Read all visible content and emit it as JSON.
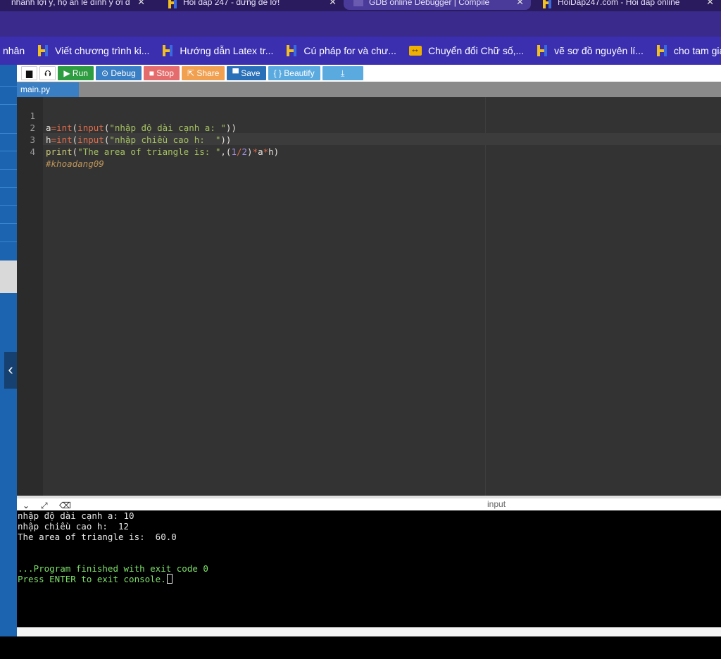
{
  "browser": {
    "tabs": [
      {
        "title": "nhanh lợi ý, hộ ăn lê đính ý ơi đ"
      },
      {
        "title": "Hỏi đáp 247 - đừng để lỡ!"
      },
      {
        "title": "GDB online Debugger | Compile"
      },
      {
        "title": "HoiDap247.com - Hỏi đáp online"
      }
    ],
    "close_glyph": "✕"
  },
  "bookmarks": [
    {
      "label": "nhân",
      "icon": "none"
    },
    {
      "label": "Viết chương trình ki...",
      "icon": "hoidap-icon"
    },
    {
      "label": "Hướng dẫn Latex tr...",
      "icon": "hoidap-icon"
    },
    {
      "label": "Cú pháp for và chư...",
      "icon": "hoidap-icon"
    },
    {
      "label": "Chuyển đổi Chữ số,...",
      "icon": "converter-icon"
    },
    {
      "label": "vẽ sơ đồ nguyên lí...",
      "icon": "hoidap-icon"
    },
    {
      "label": "cho tam giác ABC,",
      "icon": "hoidap-icon"
    }
  ],
  "toolbar": {
    "run": "▶ Run",
    "debug": "⊙ Debug",
    "stop": "■ Stop",
    "share": "⇱ Share",
    "save": "▀ Save",
    "beautify": "{ } Beautify",
    "download": "⤓"
  },
  "file_tab": "main.py",
  "editor": {
    "lines": [
      {
        "n": "1"
      },
      {
        "n": "2"
      },
      {
        "n": "3"
      },
      {
        "n": "4"
      }
    ]
  },
  "console": {
    "label": "input",
    "lines": [
      "nhập độ dài cạnh a: 10",
      "nhập chiều cao h:  12",
      "The area of triangle is:  60.0",
      "...Program finished with exit code 0",
      "Press ENTER to exit console."
    ]
  },
  "colors": {
    "sidebar": "#1c64b0",
    "run": "#2e9c40",
    "debug": "#3a7fc4",
    "stop": "#e56c6c",
    "share": "#f0a050",
    "console_success": "#7ee06a"
  }
}
